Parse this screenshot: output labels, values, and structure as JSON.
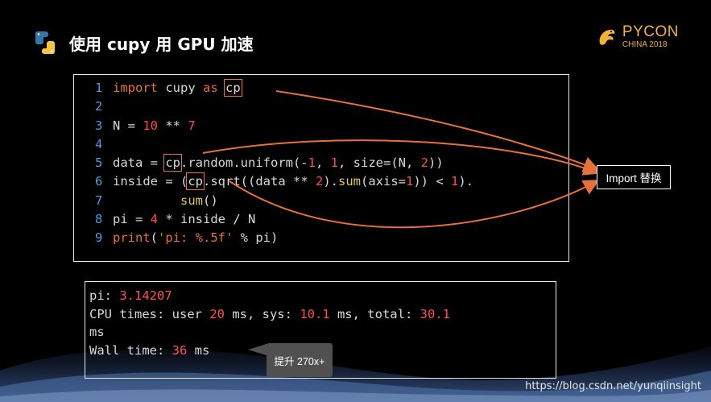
{
  "slide": {
    "title": "使用 cupy 用 GPU 加速",
    "brand": {
      "name": "PYCON",
      "subtitle": "CHINA 2018"
    },
    "callout": "Import 替换",
    "tooltip": "提升 270x+",
    "watermark": "https://blog.csdn.net/yunqiinsight"
  },
  "code": {
    "lines": [
      "1 import cupy as cp",
      "2",
      "3 N = 10 ** 7",
      "4",
      "5 data = cp.random.uniform(-1, 1, size=(N, 2))",
      "6 inside = (cp.sqrt((data ** 2).sum(axis=1)) < 1).",
      "7          sum()",
      "8 pi = 4 * inside / N",
      "9 print('pi: %.5f' % pi)"
    ]
  },
  "output": {
    "lines": [
      "pi: 3.14207",
      "CPU times: user 20 ms, sys: 10.1 ms, total: 30.1",
      "ms",
      "Wall time: 36 ms"
    ]
  },
  "colors": {
    "background": "#000000",
    "keyword": "#e8703a",
    "number": "#ff4b4b",
    "line_number": "#4d9be0",
    "function": "#e0c84a",
    "brand": "#f2b233"
  },
  "icons": [
    "python-logo-icon",
    "dragon-logo-icon",
    "arrow-icon"
  ]
}
